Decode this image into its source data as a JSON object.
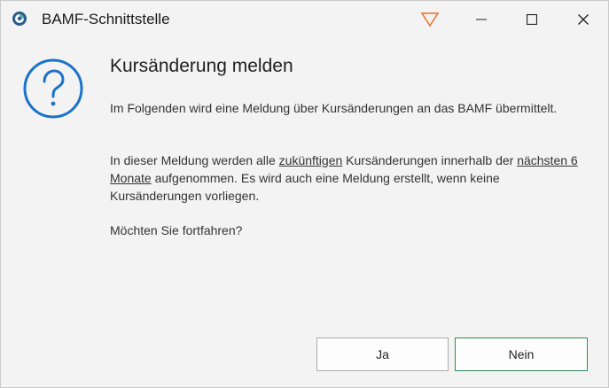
{
  "window": {
    "title": "BAMF-Schnittstelle"
  },
  "dialog": {
    "heading": "Kursänderung melden",
    "p1": "Im Folgenden wird eine Meldung über Kursänderungen an das BAMF übermittelt.",
    "p2_part1": "In dieser Meldung werden alle ",
    "p2_u1": "zukünftigen",
    "p2_part2": " Kursänderungen innerhalb der ",
    "p2_u2": "nächsten 6 Monate",
    "p2_part3": " aufgenommen. Es wird auch eine Meldung erstellt, wenn keine Kursänderungen vorliegen.",
    "p3": "Möchten Sie fortfahren?"
  },
  "buttons": {
    "yes": "Ja",
    "no": "Nein"
  },
  "icons": {
    "app": "app-logo-icon",
    "question": "question-icon",
    "filter": "filter-triangle-icon",
    "minimize": "minimize-icon",
    "maximize": "maximize-icon",
    "close": "close-icon"
  },
  "colors": {
    "accent_blue": "#1a73c8",
    "filter_orange": "#e8702a",
    "default_button_border": "#2e8b57"
  }
}
